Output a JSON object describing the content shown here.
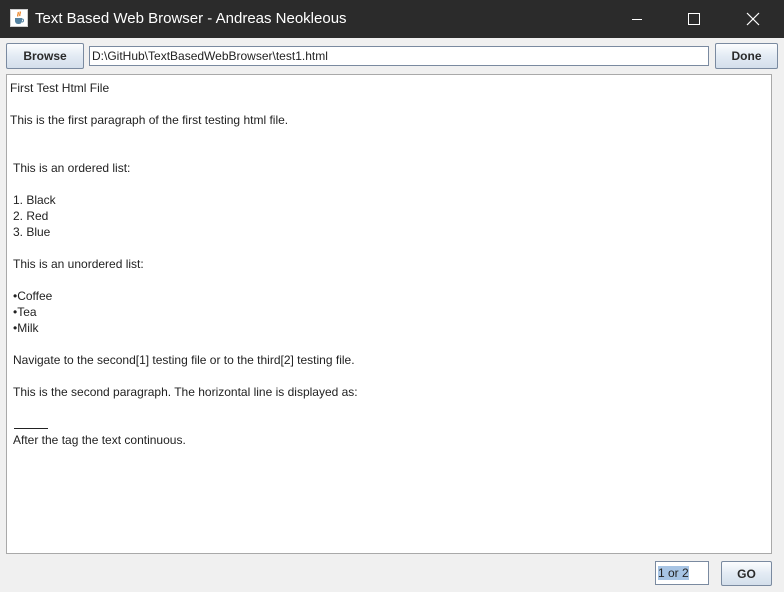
{
  "window": {
    "title": "Text Based Web Browser - Andreas Neokleous",
    "icon": "java-cup-icon",
    "controls": [
      "minimize-icon",
      "maximize-icon",
      "close-icon"
    ]
  },
  "toolbar": {
    "browse_label": "Browse",
    "url_value": "D:\\GitHub\\TextBasedWebBrowser\\test1.html",
    "done_label": "Done"
  },
  "content": {
    "lines": [
      "First Test Html File",
      "This is the first paragraph of the first testing html file.",
      "This is an ordered list:",
      "1. Black",
      "2. Red",
      "3. Blue",
      "This is an unordered list:",
      "•Coffee",
      "•Tea",
      "•Milk",
      "Navigate to the second[1] testing file or to the third[2] testing file.",
      "This is the second paragraph. The horizontal line is displayed as:",
      "After the tag the text continuous."
    ]
  },
  "footer": {
    "page_value": "1 or 2",
    "go_label": "GO"
  },
  "colors": {
    "titlebar": "#2b2b2b",
    "window_bg": "#f0f0f0",
    "selection": "#a7c4e4"
  }
}
